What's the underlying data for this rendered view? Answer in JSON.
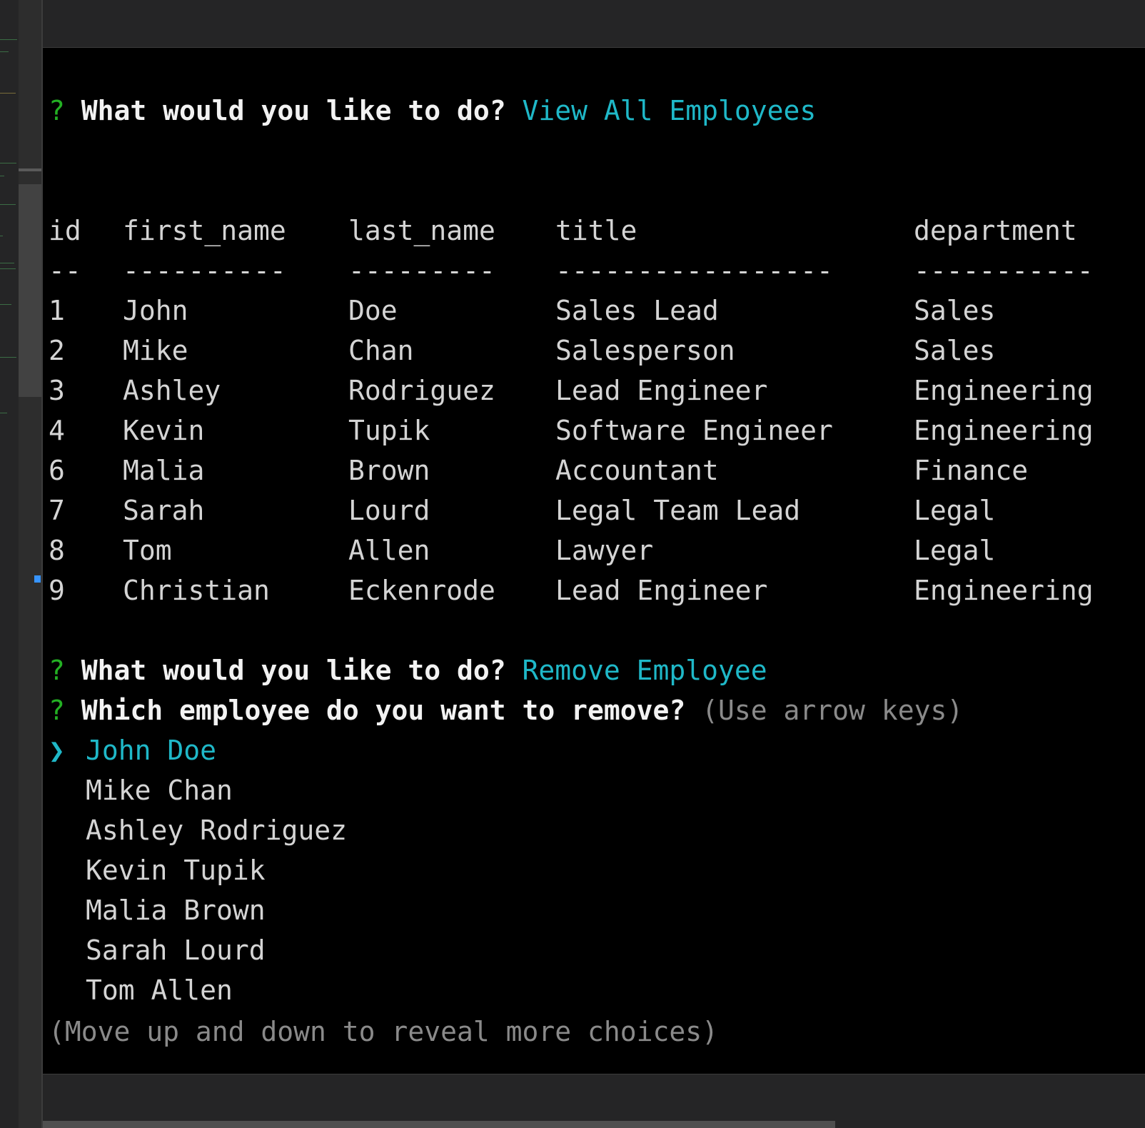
{
  "terminal": {
    "prompt1": {
      "marker": "?",
      "question": "What would you like to do?",
      "answer": "View All Employees"
    },
    "table": {
      "headers": {
        "id": "id",
        "first_name": "first_name",
        "last_name": "last_name",
        "title": "title",
        "department": "department"
      },
      "separators": {
        "id": "--",
        "first_name": "----------",
        "last_name": "---------",
        "title": "-----------------",
        "department": "-----------"
      },
      "rows": [
        {
          "id": "1",
          "first_name": "John",
          "last_name": "Doe",
          "title": "Sales Lead",
          "department": "Sales"
        },
        {
          "id": "2",
          "first_name": "Mike",
          "last_name": "Chan",
          "title": "Salesperson",
          "department": "Sales"
        },
        {
          "id": "3",
          "first_name": "Ashley",
          "last_name": "Rodriguez",
          "title": "Lead Engineer",
          "department": "Engineering"
        },
        {
          "id": "4",
          "first_name": "Kevin",
          "last_name": "Tupik",
          "title": "Software Engineer",
          "department": "Engineering"
        },
        {
          "id": "6",
          "first_name": "Malia",
          "last_name": "Brown",
          "title": "Accountant",
          "department": "Finance"
        },
        {
          "id": "7",
          "first_name": "Sarah",
          "last_name": "Lourd",
          "title": "Legal Team Lead",
          "department": "Legal"
        },
        {
          "id": "8",
          "first_name": "Tom",
          "last_name": "Allen",
          "title": "Lawyer",
          "department": "Legal"
        },
        {
          "id": "9",
          "first_name": "Christian",
          "last_name": "Eckenrode",
          "title": "Lead Engineer",
          "department": "Engineering"
        }
      ]
    },
    "prompt2": {
      "marker": "?",
      "question": "What would you like to do?",
      "answer": "Remove Employee"
    },
    "prompt3": {
      "marker": "?",
      "question": "Which employee do you want to remove?",
      "hint": "(Use arrow keys)"
    },
    "choices": {
      "pointer": "❯",
      "items": [
        "John Doe",
        "Mike Chan",
        "Ashley Rodriguez",
        "Kevin Tupik",
        "Malia Brown",
        "Sarah Lourd",
        "Tom Allen"
      ],
      "selected_index": 0,
      "footer": "(Move up and down to reveal more choices)"
    }
  },
  "colors": {
    "prompt_marker": "#23b023",
    "answer": "#1fb8c8",
    "hint": "#8a8a8a",
    "terminal_bg": "#000000"
  }
}
